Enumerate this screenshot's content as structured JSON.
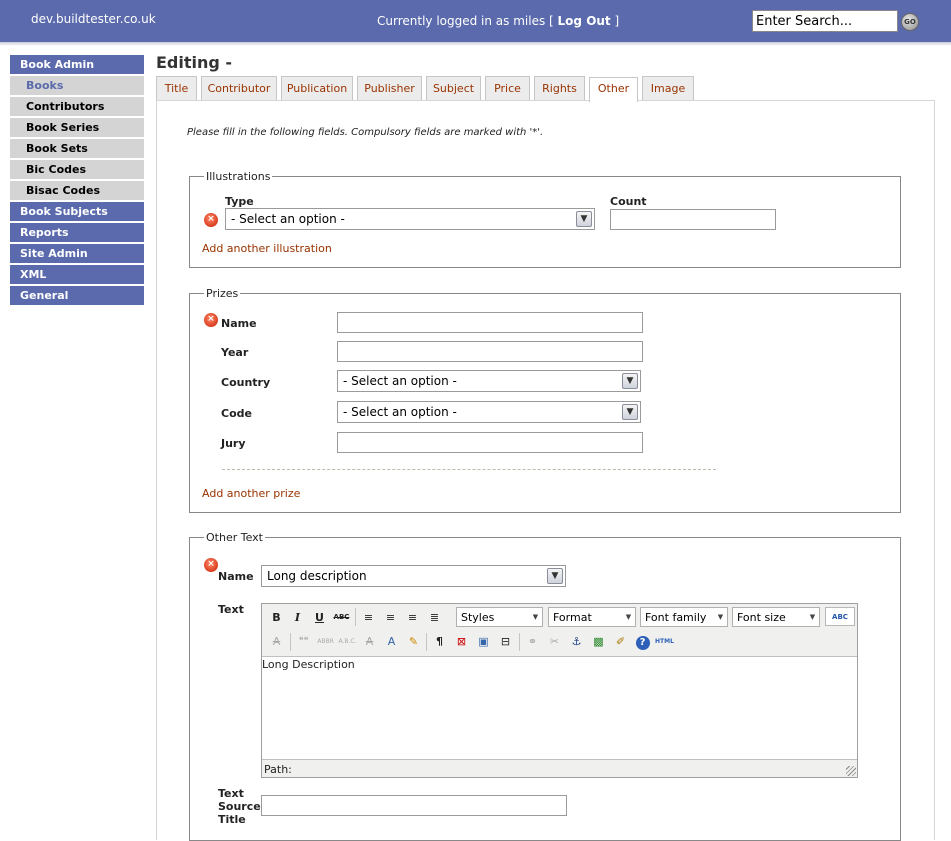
{
  "header": {
    "site_name": "dev.buildtester.co.uk",
    "login_text": "Currently logged in as miles [ ",
    "logout_label": "Log Out",
    "login_suffix": " ]",
    "search_value": "Enter Search...",
    "go_label": "GO"
  },
  "sidebar": {
    "book_admin": "Book Admin",
    "sub_items": [
      "Books",
      "Contributors",
      "Book Series",
      "Book Sets",
      "Bic Codes",
      "Bisac Codes"
    ],
    "active_sub": "Books",
    "main_items": [
      "Book Subjects",
      "Reports",
      "Site Admin",
      "XML",
      "General"
    ]
  },
  "page": {
    "title": "Editing -",
    "tabs": [
      "Title",
      "Contributor",
      "Publication",
      "Publisher",
      "Subject",
      "Price",
      "Rights",
      "Other",
      "Image"
    ],
    "active_tab": "Other",
    "intro": "Please fill in the following fields. Compulsory fields are marked with '*'."
  },
  "illustrations": {
    "legend": "Illustrations",
    "type_label": "Type",
    "type_value": "- Select an option -",
    "count_label": "Count",
    "count_value": "",
    "add_link": "Add another illustration"
  },
  "prizes": {
    "legend": "Prizes",
    "name_label": "Name",
    "name_value": "",
    "year_label": "Year",
    "year_value": "",
    "country_label": "Country",
    "country_value": "- Select an option -",
    "code_label": "Code",
    "code_value": "- Select an option -",
    "jury_label": "Jury",
    "jury_value": "",
    "add_link": "Add another prize"
  },
  "other_text": {
    "legend": "Other Text",
    "name_label": "Name",
    "name_value": "Long description",
    "text_label": "Text",
    "source_title_label_1": "Text",
    "source_title_label_2": "Source",
    "source_title_label_3": "Title",
    "source_title_value": ""
  },
  "editor": {
    "styles": "Styles",
    "format": "Format",
    "font_family": "Font family",
    "font_size": "Font size",
    "content": "Long Description",
    "path_label": "Path:",
    "buttons": {
      "bold": "B",
      "italic": "I",
      "underline": "U",
      "strike": "ABC",
      "abbr1": "ABBR",
      "acronym": "A.B.C.",
      "html": "HTML",
      "spell": "ABC"
    }
  },
  "colors": {
    "header_bg": "#5a6aac",
    "link": "#993300",
    "sidebar_sub_bg": "#d4d4d4",
    "error_icon": "#c81c00"
  }
}
